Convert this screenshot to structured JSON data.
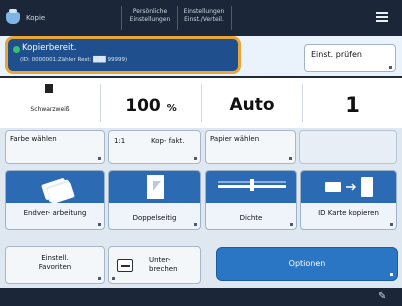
{
  "topbar": {
    "app_label": "Kopie",
    "personal_settings": "Persönliche Einstellungen",
    "settings_register": "Einstellungen Einst./Verteil.",
    "menu_icon": "hamburger-menu-icon",
    "app_icon": "copy-icon"
  },
  "status": {
    "line1": "Kopierbereit.",
    "line2": "(ID: 0000001:Zähler Rest: ███ 99999)",
    "indicator_color": "#39c16a",
    "highlight_color": "#e8a53a"
  },
  "check_button": "Einst. prüfen",
  "settings": {
    "color_mode": "Schwarzweiß",
    "zoom_value": "100",
    "zoom_unit": "%",
    "paper": "Auto",
    "copies": "1"
  },
  "row1": {
    "farbe": "Farbe wählen",
    "kop_ratio": "1:1",
    "kop_faktor": "Kop- fakt.",
    "papier": "Papier wählen"
  },
  "row2": {
    "endverarbeitung": "Endver- arbeitung",
    "doppelseitig": "Doppelseitig",
    "dichte": "Dichte",
    "id_karte": "ID Karte kopieren"
  },
  "row3": {
    "favoriten": "Einstell. Favoriten",
    "unterbrechen": "Unter- brechen",
    "optionen": "Optionen"
  },
  "footer": {
    "icon": "pen-icon"
  },
  "colors": {
    "accent_blue": "#2a75c4",
    "dark_bar": "#1b2738"
  }
}
